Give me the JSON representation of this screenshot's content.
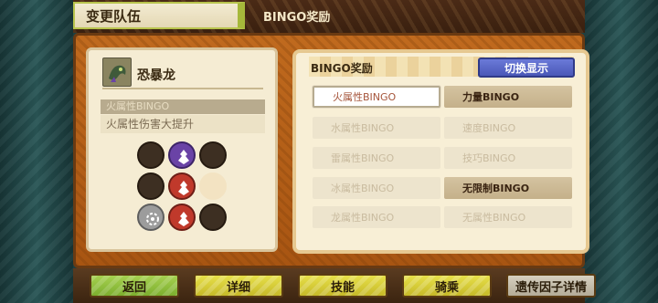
{
  "header": {
    "tab_title": "变更队伍",
    "sub_title": "BINGO奖励"
  },
  "monster": {
    "name": "恐暴龙",
    "ability_title": "火属性BINGO",
    "ability_desc": "火属性伤害大提升"
  },
  "gene_grid": [
    [
      "dark",
      "purple",
      "dark"
    ],
    [
      "dark",
      "red",
      "empty"
    ],
    [
      "grey",
      "red",
      "dark"
    ]
  ],
  "bingo_panel": {
    "title": "BINGO奖励",
    "switch_label": "切换显示",
    "items": [
      {
        "label": "火属性BINGO",
        "state": "selected"
      },
      {
        "label": "力量BINGO",
        "state": "active"
      },
      {
        "label": "水属性BINGO",
        "state": "inactive"
      },
      {
        "label": "速度BINGO",
        "state": "inactive"
      },
      {
        "label": "雷属性BINGO",
        "state": "inactive"
      },
      {
        "label": "技巧BINGO",
        "state": "inactive"
      },
      {
        "label": "冰属性BINGO",
        "state": "inactive"
      },
      {
        "label": "无限制BINGO",
        "state": "active"
      },
      {
        "label": "龙属性BINGO",
        "state": "inactive"
      },
      {
        "label": "无属性BINGO",
        "state": "inactive"
      }
    ]
  },
  "bottom_buttons": {
    "back": "返回",
    "details": "详细",
    "skills": "技能",
    "ride": "骑乘",
    "gene_details": "遗传因子详情"
  },
  "colors": {
    "switch_button": "#5a68c8",
    "back_button": "#8fc23f",
    "action_button": "#d9cf38"
  }
}
